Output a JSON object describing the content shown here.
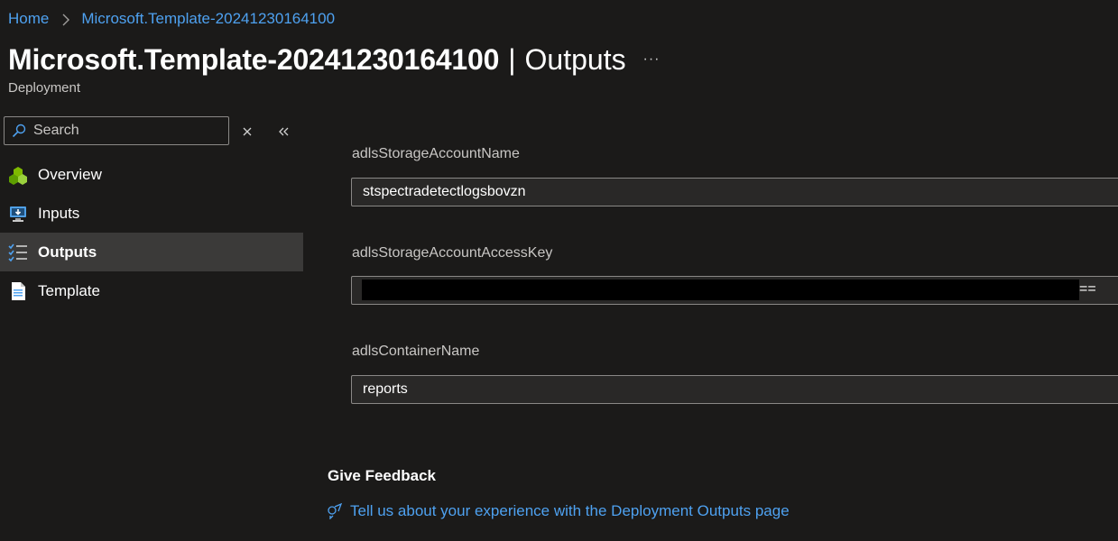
{
  "breadcrumb": {
    "items": [
      "Home",
      "Microsoft.Template-20241230164100"
    ]
  },
  "header": {
    "resource_name": "Microsoft.Template-20241230164100",
    "separator": "|",
    "section": "Outputs",
    "more_label": "···",
    "subtitle": "Deployment"
  },
  "sidebar": {
    "search_placeholder": "Search",
    "items": [
      {
        "label": "Overview",
        "icon": "overview-icon"
      },
      {
        "label": "Inputs",
        "icon": "inputs-icon"
      },
      {
        "label": "Outputs",
        "icon": "outputs-icon",
        "active": true
      },
      {
        "label": "Template",
        "icon": "template-icon"
      }
    ]
  },
  "outputs": [
    {
      "name": "adlsStorageAccountName",
      "value": "stspectradetectlogsbovzn"
    },
    {
      "name": "adlsStorageAccountAccessKey",
      "value": "",
      "visible_suffix": "=="
    },
    {
      "name": "adlsContainerName",
      "value": "reports"
    }
  ],
  "feedback": {
    "heading": "Give Feedback",
    "link": "Tell us about your experience with the Deployment Outputs page"
  },
  "colors": {
    "background": "#1b1a19",
    "link": "#4ea1f0",
    "active_nav": "#3b3a39",
    "input_bg": "#292827",
    "border": "#8a8886"
  }
}
